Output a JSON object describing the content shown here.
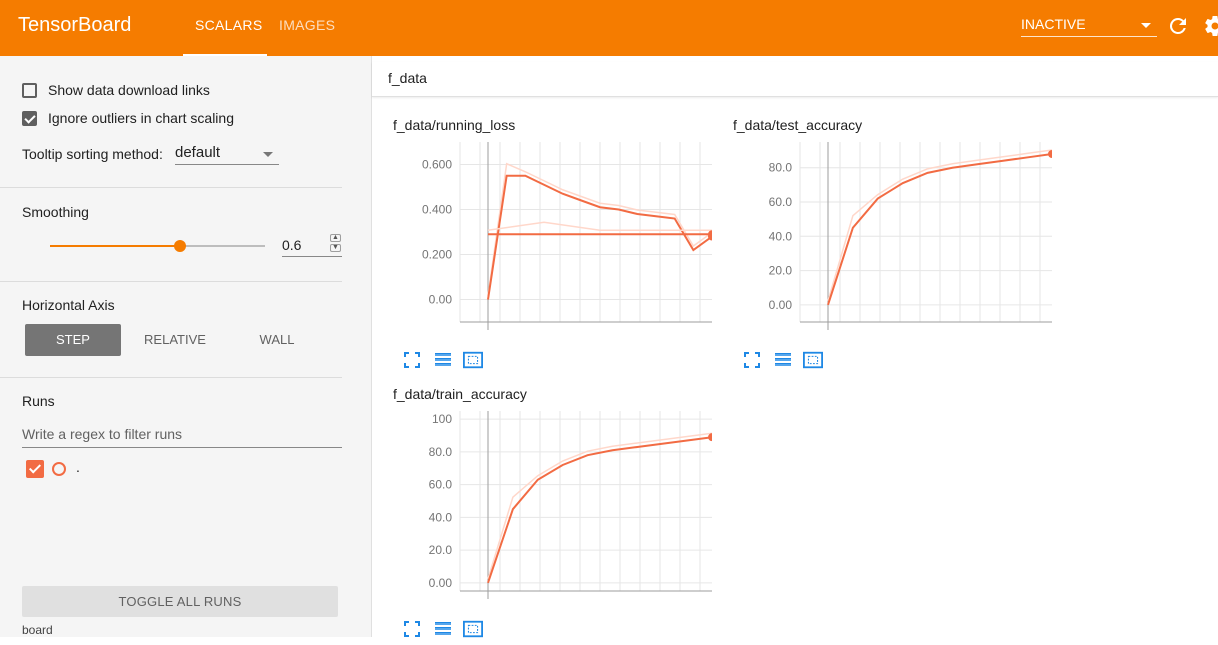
{
  "header": {
    "title": "TensorBoard",
    "tabs": [
      {
        "label": "SCALARS",
        "active": true
      },
      {
        "label": "IMAGES",
        "active": false
      }
    ],
    "status_select": "INACTIVE",
    "accent_color": "#f57c00",
    "refresh_icon": "refresh-icon",
    "settings_icon": "gear-icon"
  },
  "sidebar": {
    "options": {
      "show_download_links": {
        "label": "Show data download links",
        "checked": false
      },
      "ignore_outliers": {
        "label": "Ignore outliers in chart scaling",
        "checked": true
      },
      "tooltip_label": "Tooltip sorting method:",
      "tooltip_value": "default"
    },
    "smoothing": {
      "title": "Smoothing",
      "value": "0.6",
      "level": 0.6
    },
    "horizontal_axis": {
      "title": "Horizontal Axis",
      "options": [
        "STEP",
        "RELATIVE",
        "WALL"
      ],
      "selected": "STEP"
    },
    "runs": {
      "title": "Runs",
      "filter_placeholder": "Write a regex to filter runs",
      "items": [
        {
          "name": ".",
          "checked": true,
          "color": "#f26b43"
        }
      ],
      "toggle_label": "TOGGLE ALL RUNS",
      "footer": "board"
    }
  },
  "main": {
    "group_name": "f_data",
    "cards": [
      {
        "title": "f_data/running_loss",
        "yticks": [
          "0.600",
          "0.400",
          "0.200",
          "0.00"
        ]
      },
      {
        "title": "f_data/test_accuracy",
        "yticks": [
          "80.0",
          "60.0",
          "40.0",
          "20.0",
          "0.00"
        ]
      },
      {
        "title": "f_data/train_accuracy",
        "yticks": [
          "100",
          "80.0",
          "60.0",
          "40.0",
          "20.0",
          "0.00"
        ]
      }
    ],
    "card_action_icons": [
      "fit-to-data-icon",
      "data-table-icon",
      "zoom-box-icon"
    ]
  },
  "chart_data": [
    {
      "type": "line",
      "title": "f_data/running_loss",
      "ylim": [
        -0.1,
        0.7
      ],
      "x": [
        0,
        1,
        2,
        3,
        4,
        5,
        6,
        7,
        8,
        9,
        10,
        11,
        12
      ],
      "series": [
        {
          "values": [
            0.0,
            0.55,
            0.55,
            0.51,
            0.47,
            0.44,
            0.41,
            0.4,
            0.38,
            0.37,
            0.36,
            0.22,
            0.28
          ]
        },
        {
          "values": [
            0.29,
            0.29,
            0.29,
            0.29,
            0.29
          ]
        }
      ],
      "raw_series_color": "#ffd7ca",
      "smoothed_color": "#f26b43"
    },
    {
      "type": "line",
      "title": "f_data/test_accuracy",
      "ylim": [
        -10,
        95
      ],
      "x": [
        0,
        1,
        2,
        3,
        4,
        5,
        6,
        7,
        8,
        9
      ],
      "series": [
        {
          "values": [
            0.0,
            45,
            62,
            71,
            77,
            80,
            82,
            84,
            86,
            88
          ]
        }
      ],
      "raw_series_color": "#ffd7ca",
      "smoothed_color": "#f26b43"
    },
    {
      "type": "line",
      "title": "f_data/train_accuracy",
      "ylim": [
        -5,
        105
      ],
      "x": [
        0,
        1,
        2,
        3,
        4,
        5,
        6,
        7,
        8,
        9
      ],
      "series": [
        {
          "values": [
            0.0,
            45,
            63,
            72,
            78,
            81,
            83,
            85,
            87,
            89
          ]
        }
      ],
      "raw_series_color": "#ffd7ca",
      "smoothed_color": "#f26b43"
    }
  ]
}
